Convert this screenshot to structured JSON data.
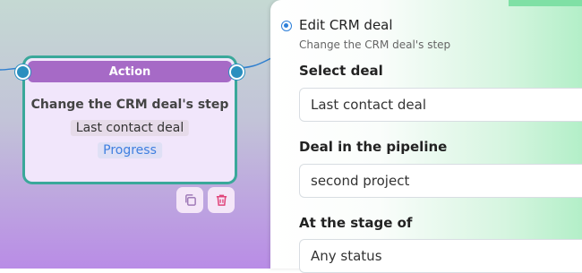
{
  "node": {
    "header": "Action",
    "title": "Change the CRM deal's step",
    "deal": "Last contact deal",
    "stage": "Progress",
    "colors": {
      "border": "#3aa89a",
      "header": "#a66ac6",
      "port": "#2a8fbf"
    }
  },
  "node_actions": [
    {
      "icon": "copy-icon"
    },
    {
      "icon": "trash-icon"
    }
  ],
  "panel": {
    "title": "Edit CRM deal",
    "subtitle": "Change the CRM deal's step",
    "fields": [
      {
        "label": "Select deal",
        "value": "Last contact deal"
      },
      {
        "label": "Deal in the pipeline",
        "value": "second project"
      },
      {
        "label": "At the stage of",
        "value": "Any status"
      }
    ]
  }
}
